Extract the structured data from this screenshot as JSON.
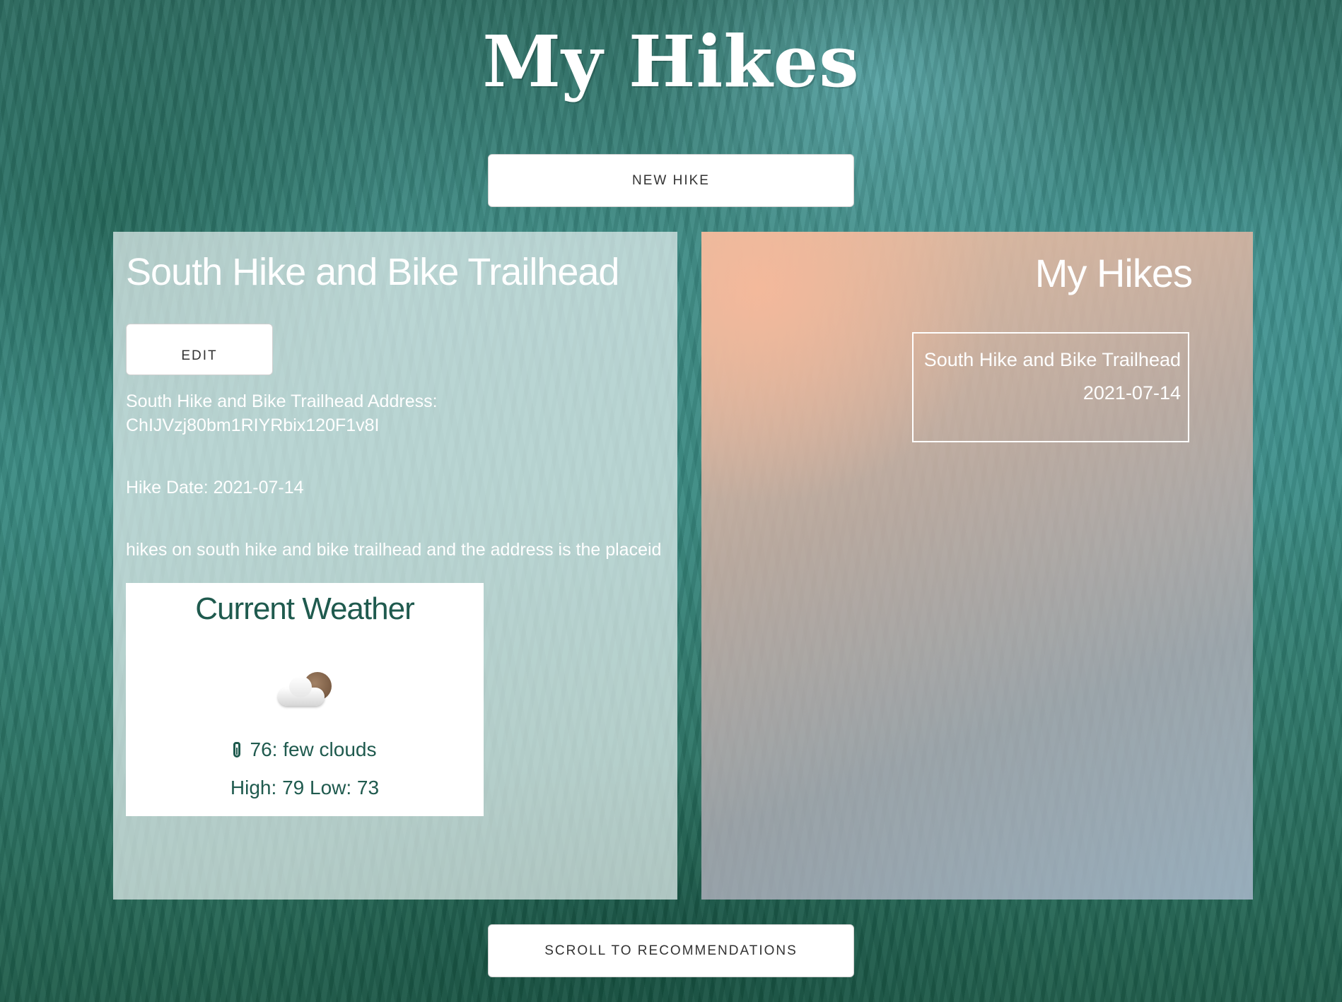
{
  "site": {
    "title": "My Hikes"
  },
  "toolbar": {
    "new_hike_label": "NEW HIKE",
    "scroll_label": "SCROLL TO RECOMMENDATIONS"
  },
  "hike_detail": {
    "title": "South Hike and Bike Trailhead",
    "edit_label": "EDIT",
    "address_line": "South Hike and Bike Trailhead Address: ChIJVzj80bm1RIYRbix120F1v8I",
    "date_line": "Hike Date: 2021-07-14",
    "notes_line": "hikes on south hike and bike trailhead and the address is the placeid"
  },
  "weather": {
    "title": "Current Weather",
    "icon": "few-clouds-icon",
    "temp_line": "76: few clouds",
    "high_low_line": "High: 79 Low: 73"
  },
  "hike_list": {
    "title": "My Hikes",
    "items": [
      {
        "label": "South Hike and Bike Trailhead 2021-07-14"
      }
    ]
  },
  "colors": {
    "weather_text": "#1f5a4e",
    "panel_accent": "#f0b99b"
  }
}
